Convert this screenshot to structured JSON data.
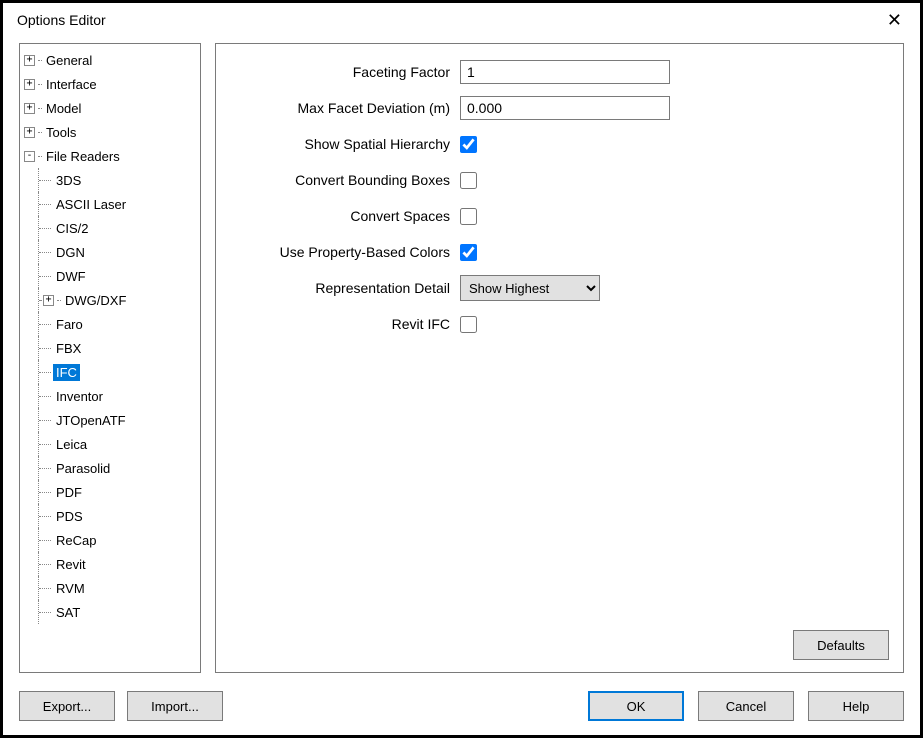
{
  "title": "Options Editor",
  "tree": {
    "top": [
      {
        "label": "General",
        "toggle": "+"
      },
      {
        "label": "Interface",
        "toggle": "+"
      },
      {
        "label": "Model",
        "toggle": "+"
      },
      {
        "label": "Tools",
        "toggle": "+"
      },
      {
        "label": "File Readers",
        "toggle": "-"
      }
    ],
    "file_readers": [
      {
        "label": "3DS"
      },
      {
        "label": "ASCII Laser"
      },
      {
        "label": "CIS/2"
      },
      {
        "label": "DGN"
      },
      {
        "label": "DWF"
      },
      {
        "label": "DWG/DXF",
        "toggle": "+"
      },
      {
        "label": "Faro"
      },
      {
        "label": "FBX"
      },
      {
        "label": "IFC",
        "selected": true
      },
      {
        "label": "Inventor"
      },
      {
        "label": "JTOpenATF"
      },
      {
        "label": "Leica"
      },
      {
        "label": "Parasolid"
      },
      {
        "label": "PDF"
      },
      {
        "label": "PDS"
      },
      {
        "label": "ReCap"
      },
      {
        "label": "Revit"
      },
      {
        "label": "RVM"
      },
      {
        "label": "SAT"
      }
    ]
  },
  "form": {
    "faceting_factor": {
      "label": "Faceting Factor",
      "value": "1"
    },
    "max_facet_deviation": {
      "label": "Max Facet Deviation (m)",
      "value": "0.000"
    },
    "show_spatial_hierarchy": {
      "label": "Show Spatial Hierarchy",
      "checked": true
    },
    "convert_bounding_boxes": {
      "label": "Convert Bounding Boxes",
      "checked": false
    },
    "convert_spaces": {
      "label": "Convert Spaces",
      "checked": false
    },
    "use_property_based_colors": {
      "label": "Use Property-Based Colors",
      "checked": true
    },
    "representation_detail": {
      "label": "Representation Detail",
      "value": "Show Highest"
    },
    "revit_ifc": {
      "label": "Revit IFC",
      "checked": false
    }
  },
  "buttons": {
    "defaults": "Defaults",
    "export": "Export...",
    "import": "Import...",
    "ok": "OK",
    "cancel": "Cancel",
    "help": "Help"
  }
}
